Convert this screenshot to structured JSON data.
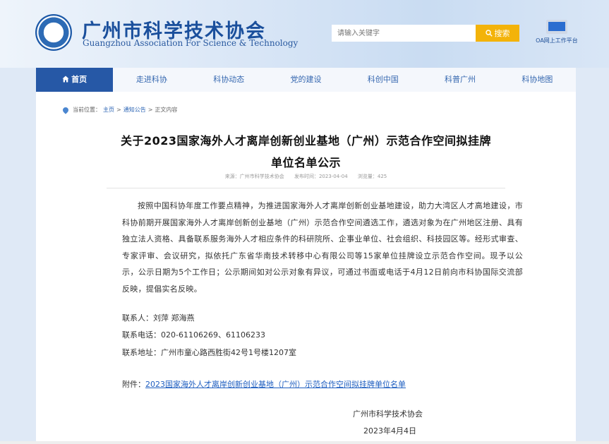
{
  "header": {
    "title_cn": "广州市科学技术协会",
    "title_en": "Guangzhou Association For Science & Technology",
    "search_placeholder": "请输入关键字",
    "search_button": "搜索",
    "oa_label": "OA网上工作平台"
  },
  "nav": {
    "items": [
      {
        "label": "首页"
      },
      {
        "label": "走进科协"
      },
      {
        "label": "科协动态"
      },
      {
        "label": "党的建设"
      },
      {
        "label": "科创中国"
      },
      {
        "label": "科普广州"
      },
      {
        "label": "科协地图"
      }
    ]
  },
  "breadcrumb": {
    "prefix": "当前位置：",
    "home": "主页",
    "section": "通知公告",
    "current": "正文内容",
    "sep": ">"
  },
  "article": {
    "title_line1": "关于2023国家海外人才离岸创新创业基地（广州）示范合作空间拟挂牌",
    "title_line2": "单位名单公示",
    "source": "来源：广州市科学技术协会",
    "published": "发布时间：2023-04-04",
    "views": "浏览量：425",
    "body": "按照中国科协年度工作要点精神，为推进国家海外人才离岸创新创业基地建设，助力大湾区人才高地建设，市科协前期开展国家海外人才离岸创新创业基地（广州）示范合作空间遴选工作，遴选对象为在广州地区注册、具有独立法人资格、具备联系服务海外人才相应条件的科研院所、企事业单位、社会组织、科技园区等。经形式审查、专家评审、会议研究，拟依托广东省华南技术转移中心有限公司等15家单位挂牌设立示范合作空间。现予以公示，公示日期为5个工作日；公示期间如对公示对象有异议，可通过书面或电话于4月12日前向市科协国际交流部反映，提倡实名反映。",
    "contact_person": "联系人：刘萍 郑海燕",
    "contact_phone": "联系电话：020-61106269、61106233",
    "contact_address": "联系地址：广州市童心路西胜街42号1号楼1207室",
    "attachment_prefix": "附件：",
    "attachment_link": "2023国家海外人才离岸创新创业基地（广州）示范合作空间拟挂牌单位名单",
    "signature_org": "广州市科学技术协会",
    "signature_date": "2023年4月4日"
  },
  "colors": {
    "nav_active": "#2658a6",
    "search_button": "#f3b30a",
    "link": "#1e5ec0"
  }
}
